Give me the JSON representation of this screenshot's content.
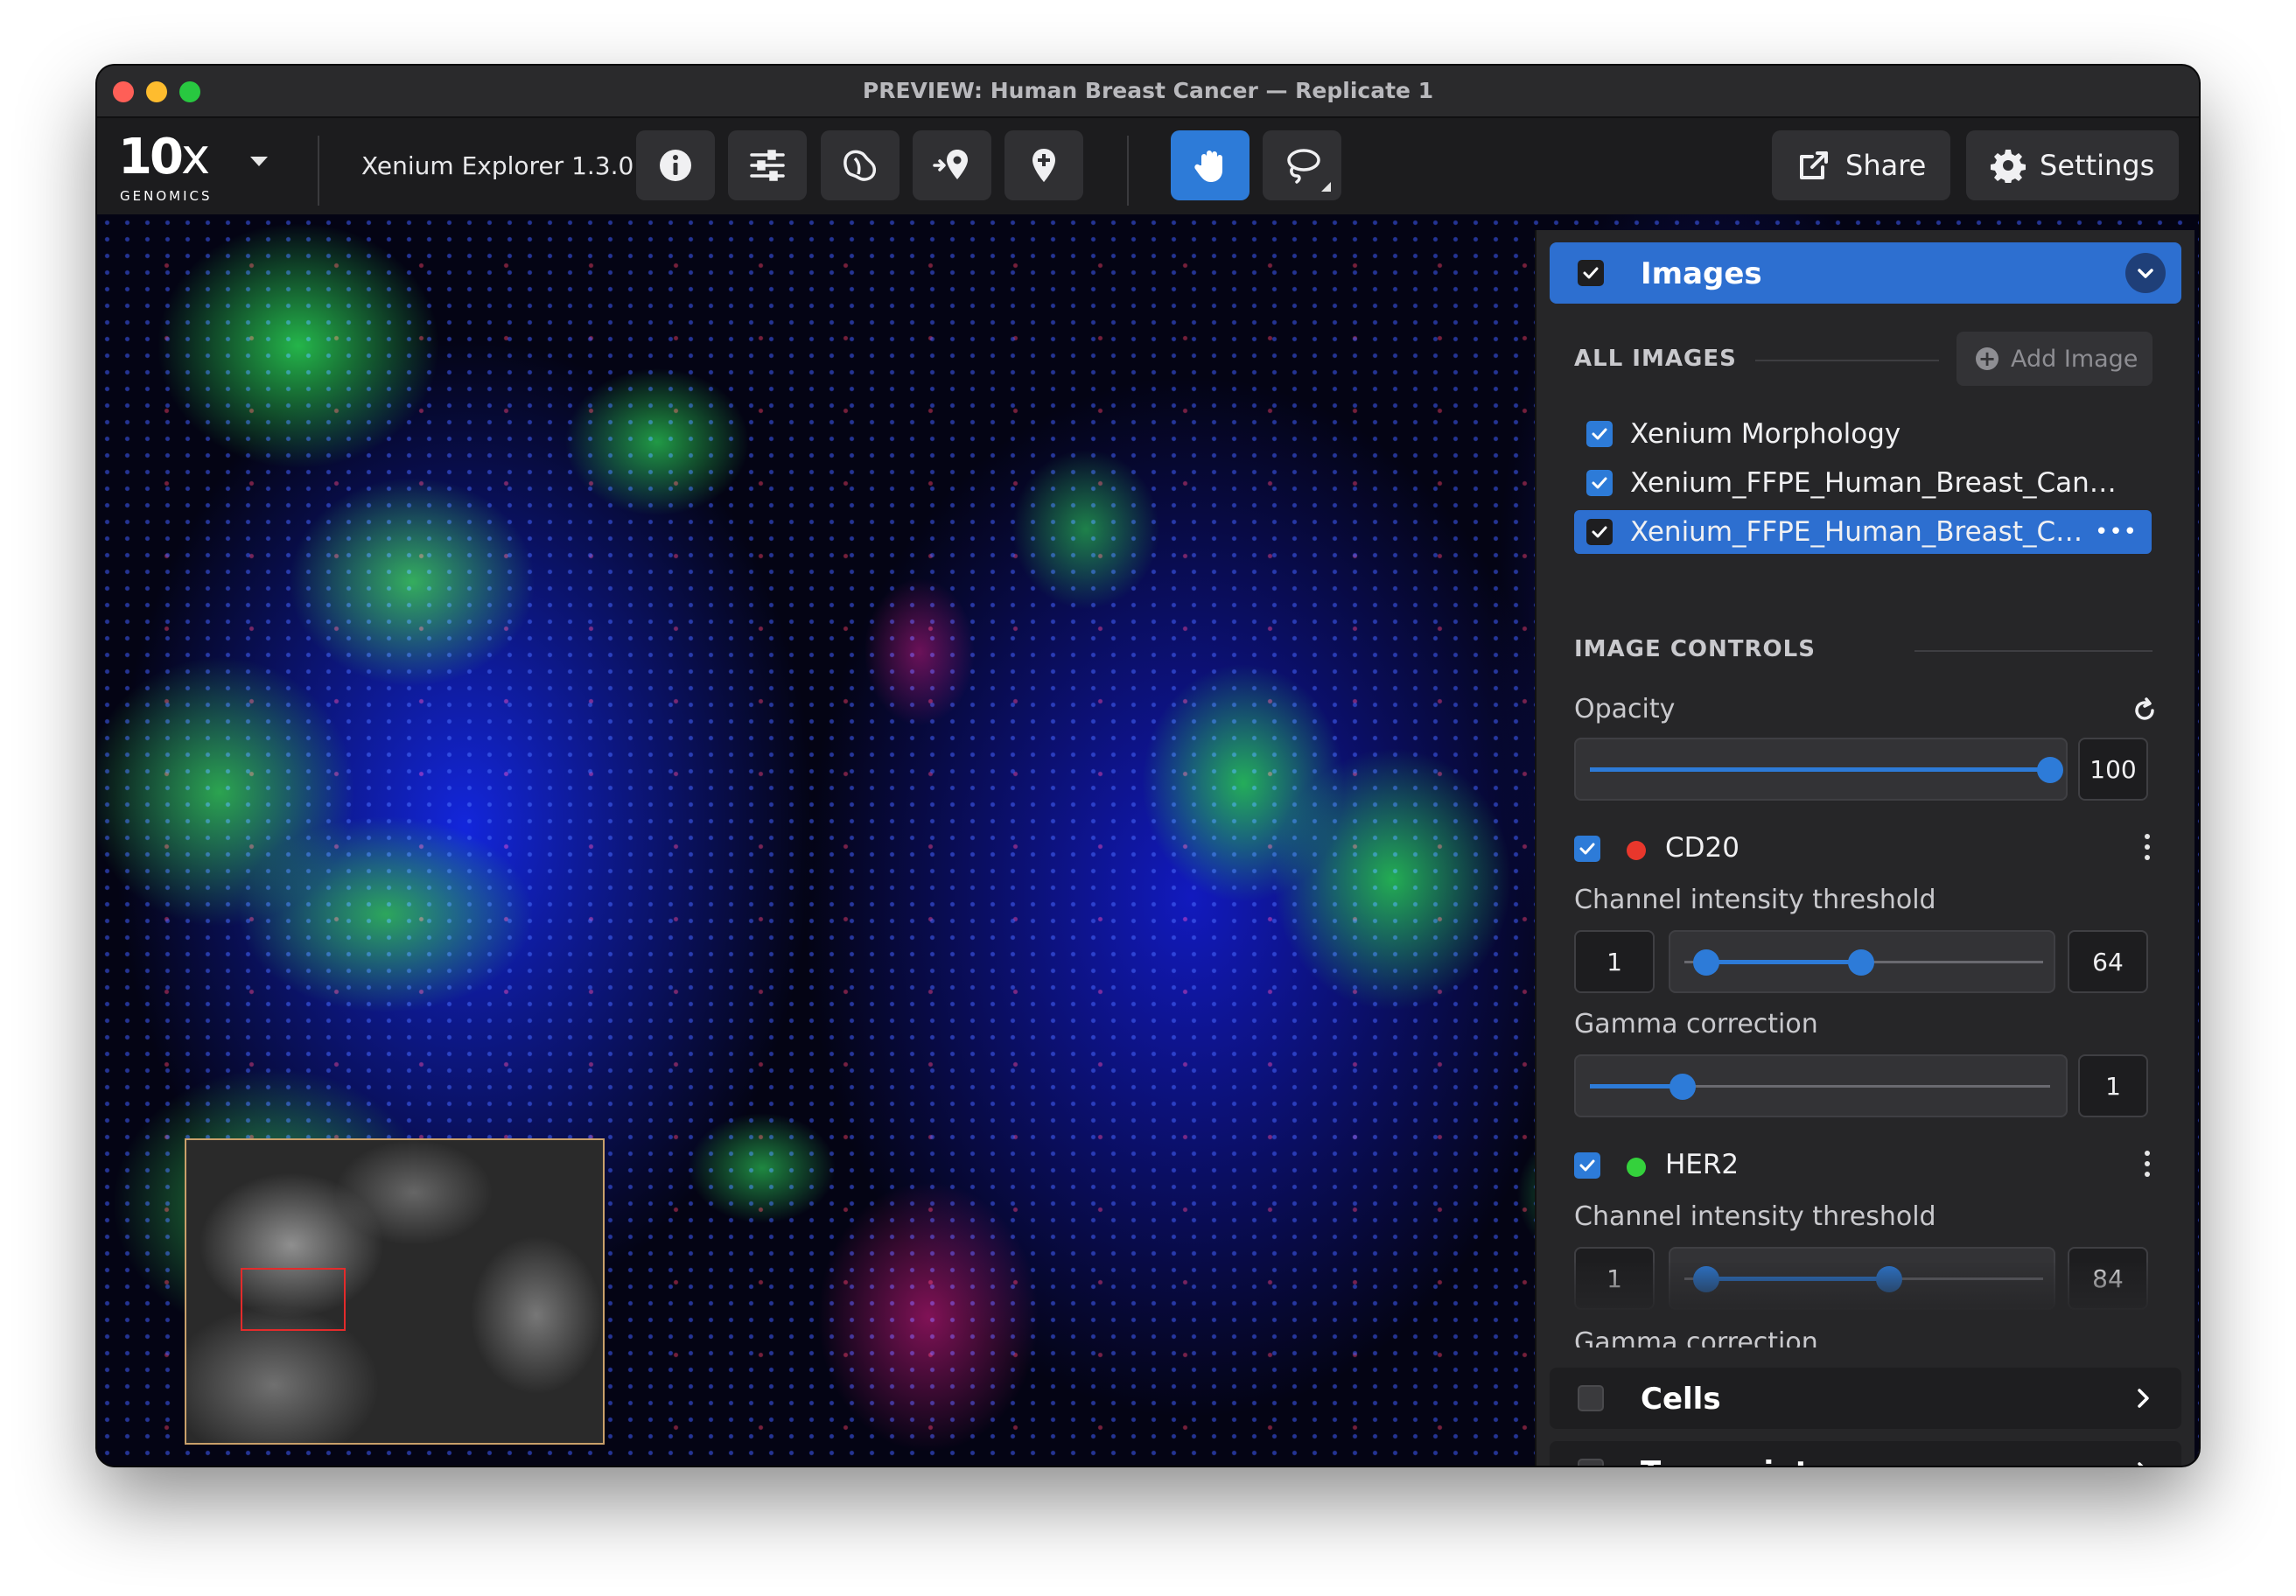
{
  "window": {
    "title": "PREVIEW: Human Breast Cancer — Replicate 1"
  },
  "toolbar": {
    "logo_main": "10",
    "logo_x": "x",
    "logo_sub": "GENOMICS",
    "app_name": "Xenium Explorer 1.3.0",
    "share_label": "Share",
    "settings_label": "Settings",
    "tools": [
      "info-icon",
      "sliders-icon",
      "cell-selection-icon",
      "goto-location-icon",
      "add-pin-icon",
      "pan-hand-icon",
      "lasso-icon"
    ],
    "active_tool": "pan-hand-icon",
    "accent": "#2d7bd8"
  },
  "panel": {
    "images": {
      "title": "Images",
      "checked": true,
      "expanded": true,
      "all_images_label": "ALL IMAGES",
      "add_image_label": "Add Image",
      "list": [
        {
          "label": "Xenium Morphology",
          "checked": true,
          "selected": false
        },
        {
          "label": "Xenium_FFPE_Human_Breast_Cancer_R...",
          "checked": true,
          "selected": false
        },
        {
          "label": "Xenium_FFPE_Human_Breast_Cance...",
          "checked": true,
          "selected": true
        }
      ],
      "image_controls_label": "IMAGE CONTROLS",
      "opacity": {
        "label": "Opacity",
        "value": "100",
        "fraction": 1.0
      },
      "channels": [
        {
          "name": "CD20",
          "color": "#e8372c",
          "checked": true,
          "threshold_label": "Channel intensity threshold",
          "min": "1",
          "max": "64",
          "low_fraction": 0.06,
          "high_fraction": 0.5,
          "gamma_label": "Gamma correction",
          "gamma": "1",
          "gamma_fraction": 0.2
        },
        {
          "name": "HER2",
          "color": "#34d13c",
          "checked": true,
          "threshold_label": "Channel intensity threshold",
          "min": "1",
          "max": "84",
          "low_fraction": 0.06,
          "high_fraction": 0.58,
          "gamma_label": "Gamma correction"
        }
      ]
    },
    "cells": {
      "title": "Cells",
      "checked": false
    },
    "transcripts": {
      "title": "Transcripts",
      "checked": false
    }
  }
}
